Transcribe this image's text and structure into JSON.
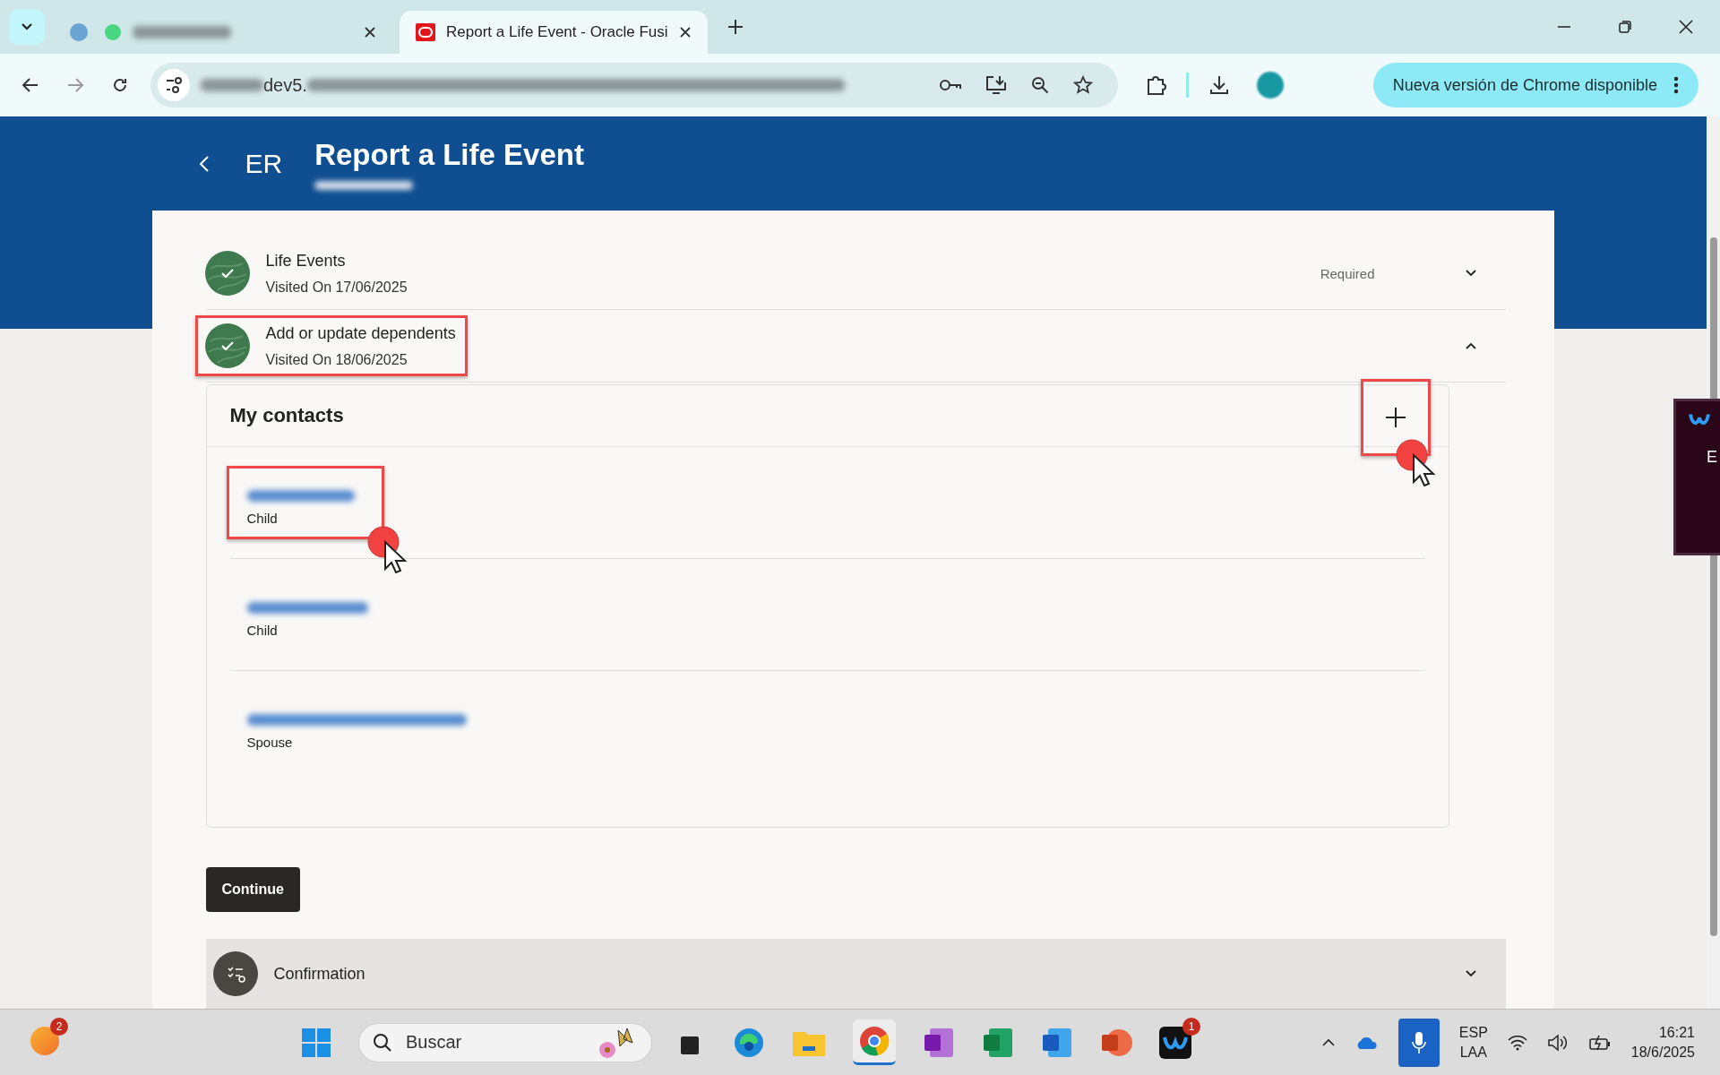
{
  "browser": {
    "tabs": [
      {
        "kind": "redacted",
        "selected": false
      },
      {
        "kind": "page",
        "title": "Report a Life Event - Oracle Fusi",
        "selected": true
      }
    ],
    "address": {
      "visible_text": "dev5."
    },
    "update_button": "Nueva versión de Chrome disponible"
  },
  "header": {
    "initials": "ER",
    "title": "Report a Life Event"
  },
  "tasks": [
    {
      "title": "Life Events",
      "subtitle": "Visited On 17/06/2025",
      "status": "Required",
      "expanded": false,
      "highlighted": false,
      "kind": "done"
    },
    {
      "title": "Add or update dependents",
      "subtitle": "Visited On 18/06/2025",
      "expanded": true,
      "highlighted": true,
      "kind": "done"
    }
  ],
  "contacts": {
    "title": "My contacts",
    "add_highlighted": true,
    "items": [
      {
        "relation": "Child",
        "highlighted": true
      },
      {
        "relation": "Child",
        "highlighted": false
      },
      {
        "relation": "Spouse",
        "highlighted": false
      }
    ]
  },
  "continue_button": "Continue",
  "side_panel": {
    "text": "E"
  },
  "confirmation": {
    "title": "Confirmation",
    "expanded": false,
    "kind": "pending"
  },
  "taskbar": {
    "notification_badge": "2",
    "search_placeholder": "Buscar",
    "teams_badge": "1",
    "language": "ESP",
    "layout": "LAA",
    "time": "16:21",
    "date": "18/6/2025"
  }
}
